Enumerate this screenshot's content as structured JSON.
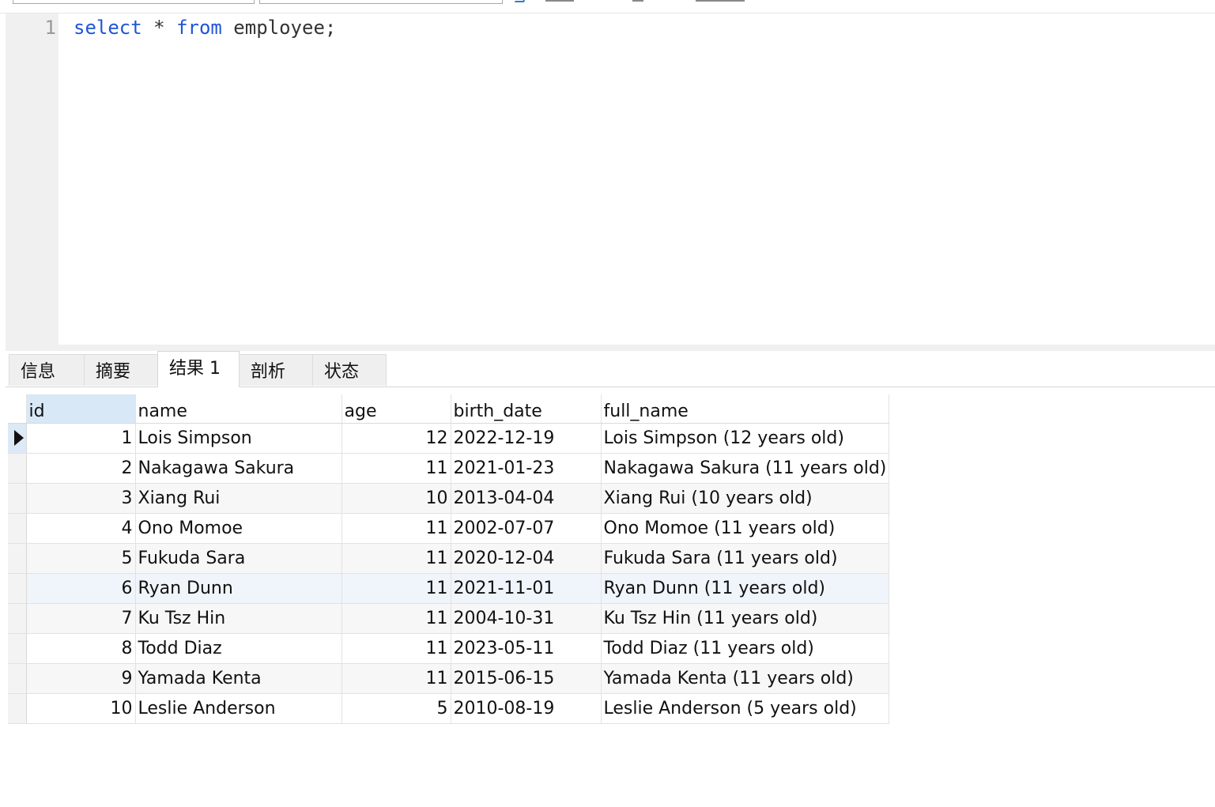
{
  "editor": {
    "line_number": "1",
    "code_tokens": {
      "kw_select": "select",
      "star": " * ",
      "kw_from": "from",
      "rest": " employee;"
    },
    "keyword_color": "#1f55d6"
  },
  "tabs": [
    {
      "label": "信息"
    },
    {
      "label": "摘要"
    },
    {
      "label": "结果 1"
    },
    {
      "label": "剖析"
    },
    {
      "label": "状态"
    }
  ],
  "active_tab": "结果 1",
  "grid": {
    "columns": [
      "id",
      "name",
      "age",
      "birth_date",
      "full_name"
    ],
    "rows": [
      {
        "id": "1",
        "name": "Lois Simpson",
        "age": "12",
        "birth_date": "2022-12-19",
        "full_name": "Lois Simpson (12 years old)"
      },
      {
        "id": "2",
        "name": "Nakagawa Sakura",
        "age": "11",
        "birth_date": "2021-01-23",
        "full_name": "Nakagawa Sakura (11 years old)"
      },
      {
        "id": "3",
        "name": "Xiang Rui",
        "age": "10",
        "birth_date": "2013-04-04",
        "full_name": "Xiang Rui (10 years old)"
      },
      {
        "id": "4",
        "name": "Ono Momoe",
        "age": "11",
        "birth_date": "2002-07-07",
        "full_name": "Ono Momoe (11 years old)"
      },
      {
        "id": "5",
        "name": "Fukuda Sara",
        "age": "11",
        "birth_date": "2020-12-04",
        "full_name": "Fukuda Sara (11 years old)"
      },
      {
        "id": "6",
        "name": "Ryan Dunn",
        "age": "11",
        "birth_date": "2021-11-01",
        "full_name": "Ryan Dunn (11 years old)"
      },
      {
        "id": "7",
        "name": "Ku Tsz Hin",
        "age": "11",
        "birth_date": "2004-10-31",
        "full_name": "Ku Tsz Hin (11 years old)"
      },
      {
        "id": "8",
        "name": "Todd Diaz",
        "age": "11",
        "birth_date": "2023-05-11",
        "full_name": "Todd Diaz (11 years old)"
      },
      {
        "id": "9",
        "name": "Yamada Kenta",
        "age": "11",
        "birth_date": "2015-06-15",
        "full_name": "Yamada Kenta (11 years old)"
      },
      {
        "id": "10",
        "name": "Leslie Anderson",
        "age": "5",
        "birth_date": "2010-08-19",
        "full_name": "Leslie Anderson (5 years old)"
      }
    ],
    "selected_row_index": 0,
    "selected_column": "id",
    "selection_color": "#d9e8f7"
  }
}
